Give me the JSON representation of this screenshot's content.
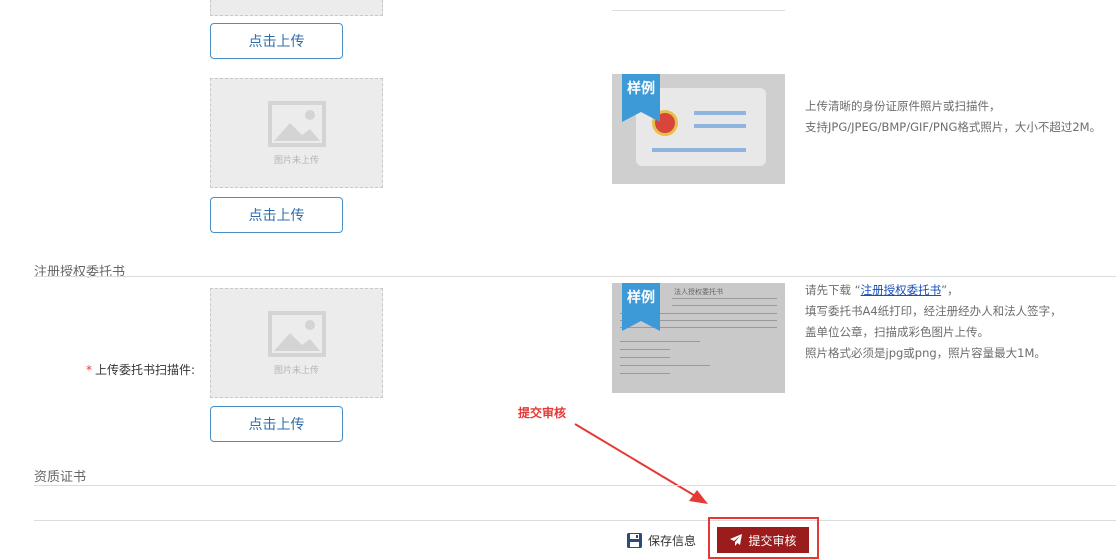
{
  "upload": {
    "button_label": "点击上传",
    "placeholder_text": "图片未上传"
  },
  "sample": {
    "ribbon_label": "样例"
  },
  "id_card": {
    "notes": [
      "上传清晰的身份证原件照片或扫描件，",
      "支持JPG/JPEG/BMP/GIF/PNG格式照片，大小不超过2M。"
    ]
  },
  "authorization": {
    "section_title": "注册授权委托书",
    "field_label": "上传委托书扫描件:",
    "required_mark": "*",
    "note_prefix": "请先下载 “",
    "note_link": "注册授权委托书",
    "note_suffix": "”，",
    "notes": [
      "填写委托书A4纸打印，经注册经办人和法人签字，",
      "盖单位公章，扫描成彩色图片上传。",
      "照片格式必须是jpg或png，照片容量最大1M。"
    ],
    "doc_title": "法人授权委托书"
  },
  "qualification": {
    "section_title": "资质证书"
  },
  "annotation": {
    "callout_label": "提交审核",
    "color": "#e53935"
  },
  "footer": {
    "save_label": "保存信息",
    "submit_label": "提交审核"
  },
  "colors": {
    "accent": "#3e9ad6",
    "submit_bg": "#9b1c1c",
    "highlight_border": "#e53935"
  }
}
